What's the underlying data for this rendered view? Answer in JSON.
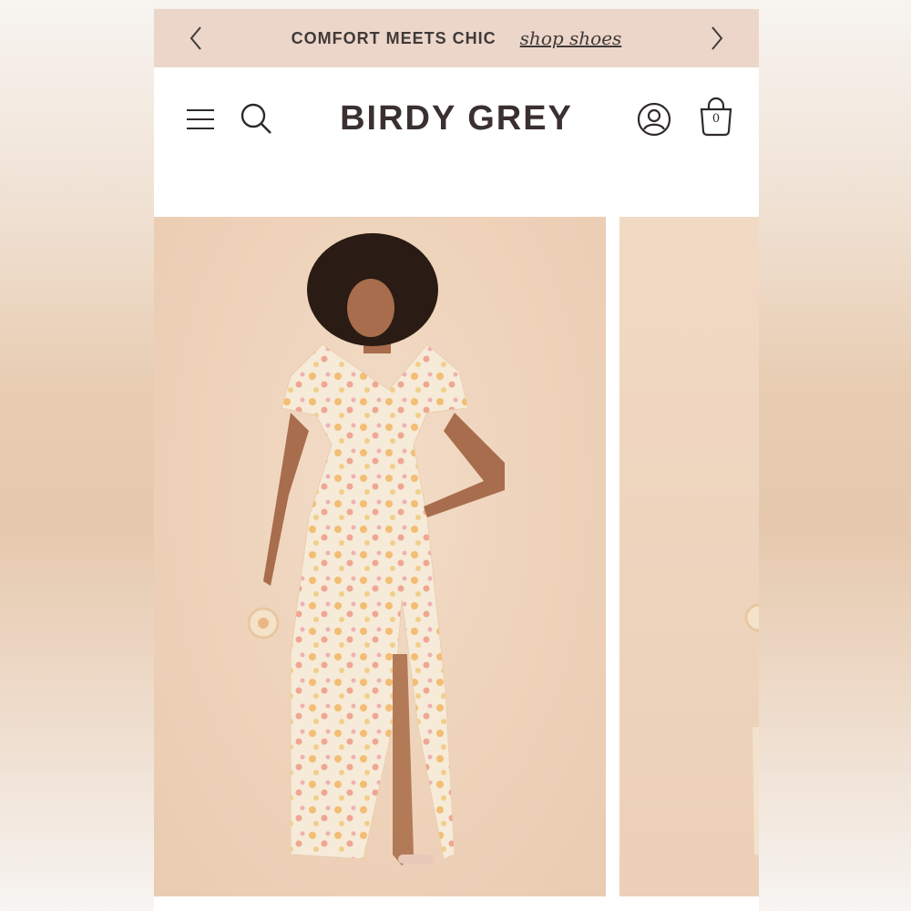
{
  "promo": {
    "text": "COMFORT MEETS CHIC",
    "link": "shop shoes"
  },
  "header": {
    "logo": "BIRDY GREY",
    "cart_count": "0",
    "icons": [
      "menu-icon",
      "search-icon",
      "account-icon",
      "shopping-bag-icon"
    ]
  },
  "gallery": {
    "images": [
      {
        "name": "product-photo-main",
        "description_icon": "model-in-floral-maxi-dress"
      },
      {
        "name": "product-photo-next"
      }
    ]
  },
  "colors": {
    "promo_bg": "#ecd6c9",
    "photo_bg": "#efd4bd",
    "logo": "#3b3030",
    "text": "#3f3a39"
  }
}
